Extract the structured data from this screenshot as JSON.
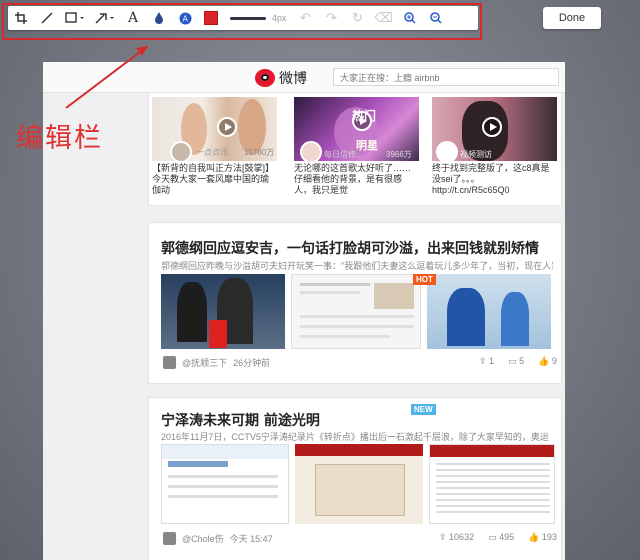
{
  "toolbar": {
    "stroke_size": "4px",
    "color_accent": "#d9232a",
    "icons": [
      "crop-icon",
      "pen-icon",
      "rectangle-icon",
      "arrow-icon",
      "text-icon",
      "blur-icon",
      "sticker-icon",
      "color-swatch",
      "undo-icon",
      "redo-icon",
      "rotate-icon",
      "eraser-icon",
      "zoom-in-icon",
      "zoom-out-icon"
    ]
  },
  "done_label": "Done",
  "annotation_label": "编辑栏",
  "weibo": {
    "logo_text": "微博",
    "search_placeholder": "大家正在搜：上瘾 airbnb"
  },
  "videos": [
    {
      "badge": "一点点讯",
      "count": "15780万",
      "snippet": "【新背的自我叫正方法[鼓掌]】今天教大家一套风靡中国的瑜伽动"
    },
    {
      "overlay_1": "热门",
      "overlay_2": "明星",
      "channel": "每日信修...",
      "count": "3966万",
      "snippet": "无论哪的这首歌太好听了……仔细看他的背景，是有很感人，我只是觉"
    },
    {
      "channel": "视频测访",
      "count": "",
      "snippet": "终于找到完整版了，这c8真是没sei了。。。 http://t.cn/R5c65Q0"
    }
  ],
  "article1": {
    "title": "郭德纲回应逗安吉，一句话打脸胡可沙溢，出来回钱就别矫情",
    "summary": "郭德纲回应昨晚与沙溢胡可夫妇开玩笑一事：\"我跟他们夫妻这么逗着玩儿多少年了，当初，现在人家不",
    "badge": "HOT",
    "author": "@抚顺三下",
    "time": "26分钟前",
    "reposts": "1",
    "comments": "5",
    "likes": "9"
  },
  "article2": {
    "title": "宁泽涛未来可期 前途光明",
    "summary": "2016年11月7日，CCTV5宁泽涛纪录片《转折点》播出后一石激起千层浪，除了大家早知的，奥运",
    "badge": "NEW",
    "author": "@Chole伤",
    "time": "今天 15:47",
    "reposts": "10632",
    "comments": "495",
    "likes": "193"
  }
}
